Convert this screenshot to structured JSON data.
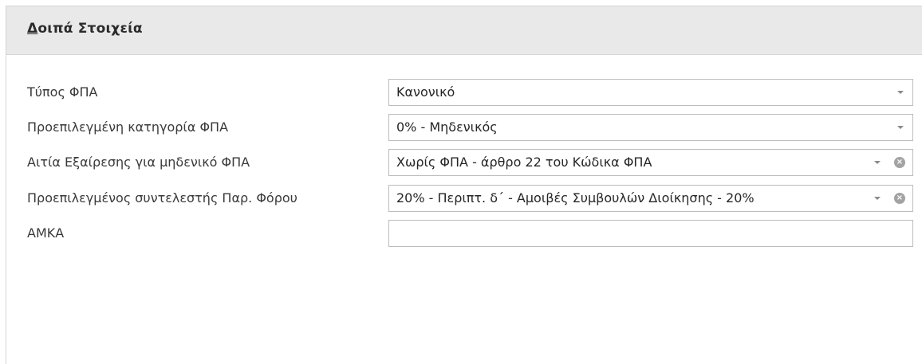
{
  "panel": {
    "title_mnemonic": "Δ",
    "title_rest": "οιπά Στοιχεία"
  },
  "fields": [
    {
      "label": "Τύπος ΦΠΑ",
      "value": "Κανονικό",
      "dropdown_icon": "chevron-down-icon",
      "has_clear": false
    },
    {
      "label": "Προεπιλεγμένη κατηγορία ΦΠΑ",
      "value": "0% - Μηδενικός",
      "dropdown_icon": "chevron-down-icon",
      "has_clear": false
    },
    {
      "label": "Αιτία Εξαίρεσης για μηδενικό ΦΠΑ",
      "value": "Χωρίς ΦΠΑ - άρθρο 22 του Κώδικα ΦΠΑ",
      "dropdown_icon": "chevron-down-icon",
      "has_clear": true,
      "clear_icon": "clear-circle-icon",
      "clear_glyph": "×"
    },
    {
      "label": "Προεπιλεγμένος συντελεστής Παρ. Φόρου",
      "value": "20% - Περιπτ. δ΄ - Αμοιβές Συμβουλών Διοίκησης - 20%",
      "dropdown_icon": "chevron-down-icon",
      "has_clear": true,
      "clear_icon": "clear-circle-icon",
      "clear_glyph": "×"
    },
    {
      "label": "ΑΜΚΑ",
      "value": ""
    }
  ],
  "colors": {
    "header_bg": "#e9e9e9",
    "field_border": "#bcbcbc",
    "icon_gray": "#8a8a8a"
  }
}
